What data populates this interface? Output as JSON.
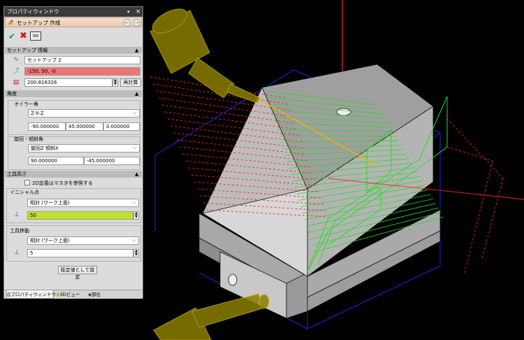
{
  "panel": {
    "title": "プロパティウィンドウ",
    "command_title": "セットアップ 作成",
    "setup_section": {
      "header": "セットアップ 情報",
      "name_value": "セットアップ 2",
      "origin_value": "-150, 50, -0",
      "distance_value": "200.818326",
      "recalc_label": "再計算"
    },
    "angle_section": {
      "header": "角度",
      "euler_label": "オイラー角",
      "euler_order": "Z-X-Z",
      "euler_values": [
        "-90.000000",
        "45.000000",
        "0.000000"
      ],
      "rot_label": "旋回・傾斜角",
      "rot_mode": "旋回Z 傾斜X",
      "rot_values": [
        "90.000000",
        "-45.000000"
      ]
    },
    "tool_height_section": {
      "header": "工具高さ",
      "checkbox_label": "2D定義はマスタを参照する",
      "initial_point_label": "イニシャル点",
      "initial_point_mode": "相対 (ワーク上面)",
      "initial_point_value": "50",
      "tool_move_label": "工具移動",
      "tool_move_mode": "相対 (ワーク上面)",
      "tool_move_value": "5",
      "default_button_label": "既定値として設定"
    },
    "tabs": [
      {
        "label": "プロパティウィンドウ",
        "active": true
      },
      {
        "label": "3Dビュー",
        "active": false
      },
      {
        "label": "部位",
        "active": false
      }
    ]
  },
  "colors": {
    "panel_bg": "#dcdcdc",
    "title_bg": "#3a3a3a",
    "origin_field": "#ef7474",
    "initial_point_field": "#bde22a",
    "toolpath_green": "#22dd22",
    "approach_red": "#ff2020",
    "bounding_box_blue": "#2a2aff",
    "tool_yellow": "#b0a000"
  },
  "icons": [
    "pin-icon",
    "close-icon",
    "setup-icon",
    "back-icon",
    "forward-icon",
    "check-icon",
    "cancel-icon",
    "preview-icon",
    "origin-icon",
    "direction-icon",
    "distance-icon",
    "height-icon",
    "collapse-icon",
    "dropdown-icon"
  ]
}
